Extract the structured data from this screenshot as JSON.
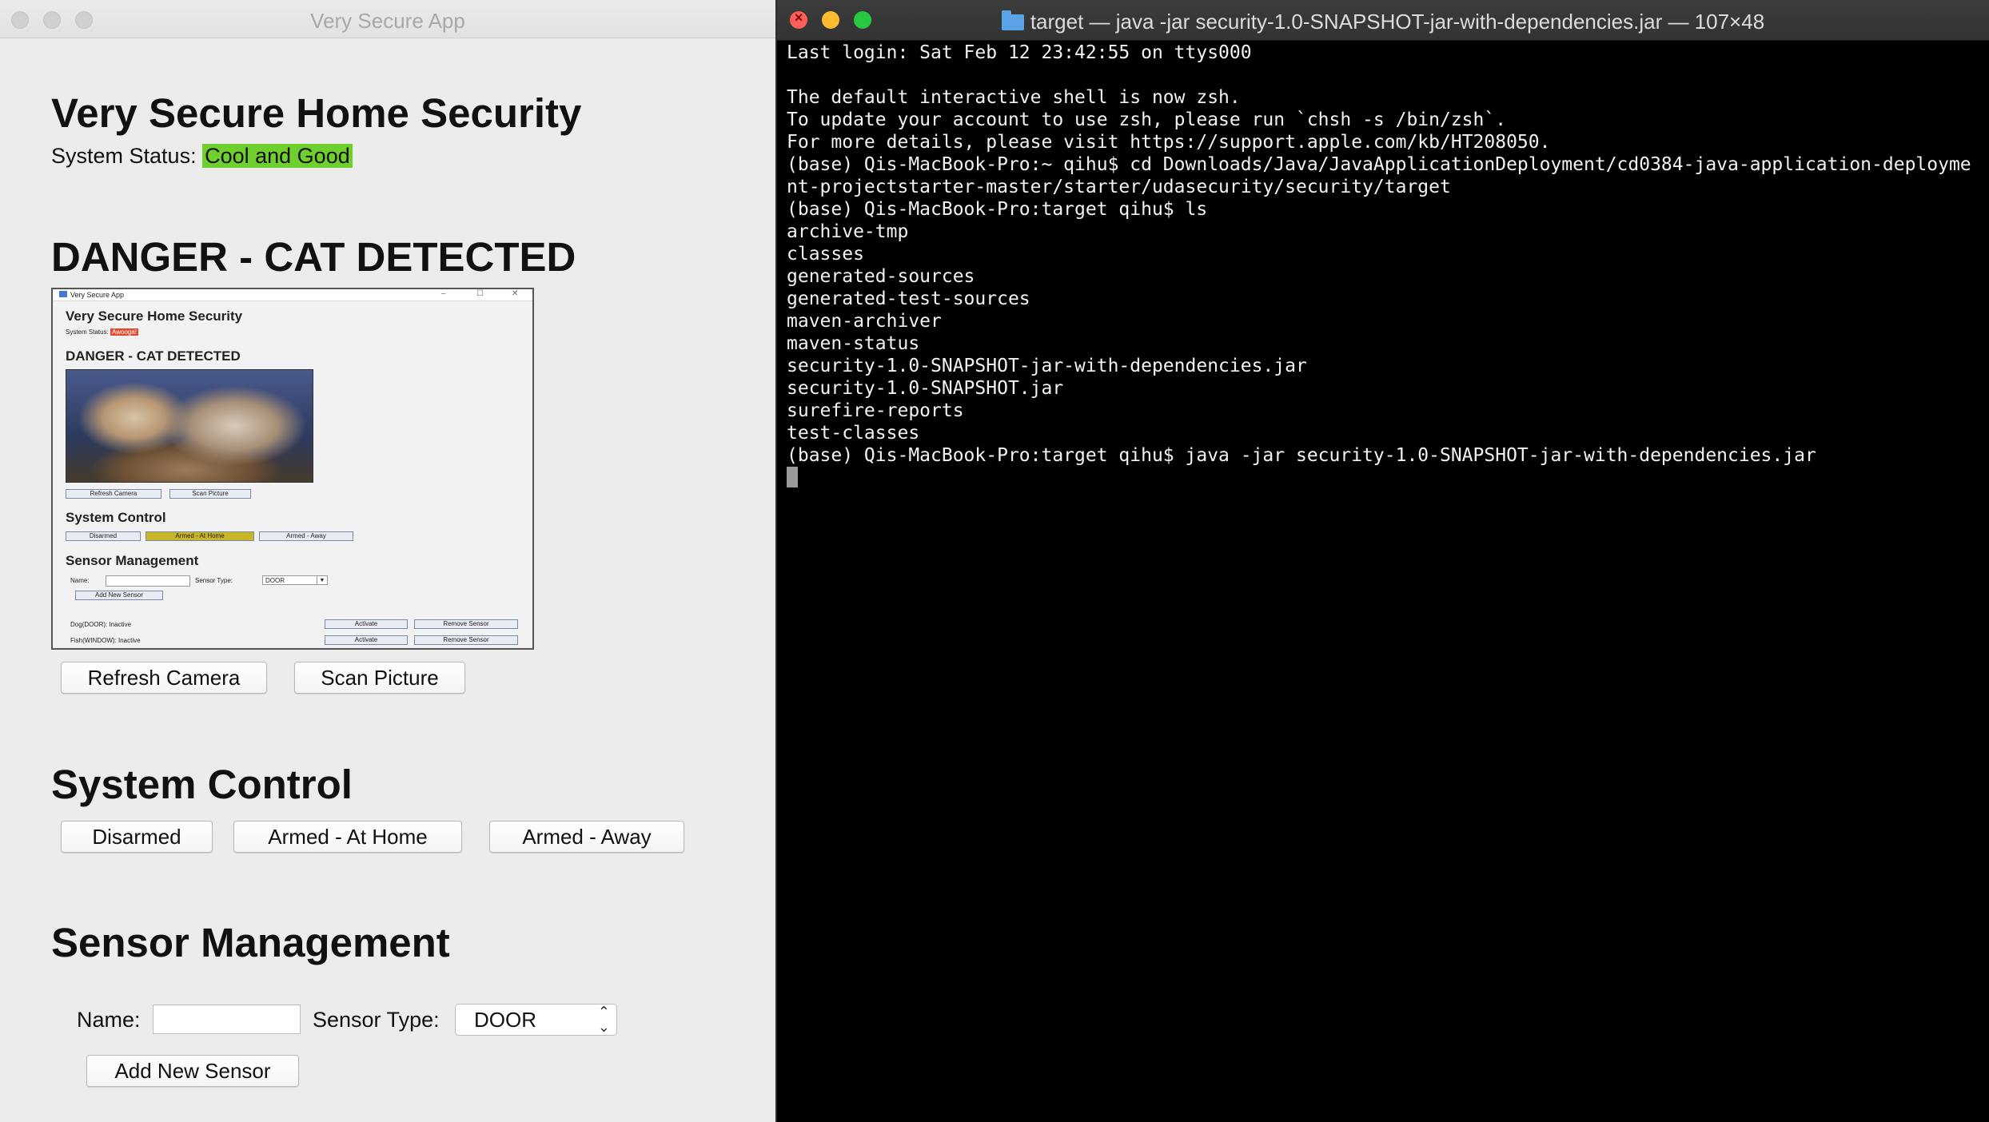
{
  "app": {
    "window_title": "Very Secure App",
    "heading": "Very Secure Home Security",
    "status_label": "System Status:",
    "status_value": "Cool and Good",
    "status_color": "#6fcf2f",
    "camera_section_title": "DANGER - CAT DETECTED",
    "refresh_camera_label": "Refresh Camera",
    "scan_picture_label": "Scan Picture",
    "system_control_title": "System Control",
    "disarmed_label": "Disarmed",
    "armed_home_label": "Armed - At Home",
    "armed_away_label": "Armed - Away",
    "sensor_management_title": "Sensor Management",
    "name_label": "Name:",
    "name_value": "",
    "sensor_type_label": "Sensor Type:",
    "sensor_type_selected": "DOOR",
    "add_sensor_label": "Add New Sensor"
  },
  "camera_image": {
    "window_title": "Very Secure App",
    "heading": "Very Secure Home Security",
    "status_label": "System Status:",
    "status_value": "Awooga!",
    "status_color": "#e2492f",
    "camera_section_title": "DANGER - CAT DETECTED",
    "refresh_camera_label": "Refresh Camera",
    "scan_picture_label": "Scan Picture",
    "system_control_title": "System Control",
    "disarmed_label": "Disarmed",
    "armed_home_label": "Armed - At Home",
    "armed_away_label": "Armed - Away",
    "sensor_management_title": "Sensor Management",
    "name_label": "Name:",
    "sensor_type_label": "Sensor Type:",
    "sensor_type_selected": "DOOR",
    "add_sensor_label": "Add New Sensor",
    "sensors": [
      {
        "name": "Dog(DOOR): Inactive",
        "activate_label": "Activate",
        "remove_label": "Remove Sensor"
      },
      {
        "name": "Fish(WINDOW): Inactive",
        "activate_label": "Activate",
        "remove_label": "Remove Sensor"
      }
    ]
  },
  "terminal": {
    "window_title": "target — java -jar security-1.0-SNAPSHOT-jar-with-dependencies.jar — 107×48",
    "lines": [
      "Last login: Sat Feb 12 23:42:55 on ttys000",
      "",
      "The default interactive shell is now zsh.",
      "To update your account to use zsh, please run `chsh -s /bin/zsh`.",
      "For more details, please visit https://support.apple.com/kb/HT208050.",
      "(base) Qis-MacBook-Pro:~ qihu$ cd Downloads/Java/JavaApplicationDeployment/cd0384-java-application-deployme",
      "nt-projectstarter-master/starter/udasecurity/security/target",
      "(base) Qis-MacBook-Pro:target qihu$ ls",
      "archive-tmp",
      "classes",
      "generated-sources",
      "generated-test-sources",
      "maven-archiver",
      "maven-status",
      "security-1.0-SNAPSHOT-jar-with-dependencies.jar",
      "security-1.0-SNAPSHOT.jar",
      "surefire-reports",
      "test-classes",
      "(base) Qis-MacBook-Pro:target qihu$ java -jar security-1.0-SNAPSHOT-jar-with-dependencies.jar"
    ]
  },
  "colors": {
    "armed_home_highlight": "#c9b52a",
    "terminal_bg": "#000000"
  }
}
